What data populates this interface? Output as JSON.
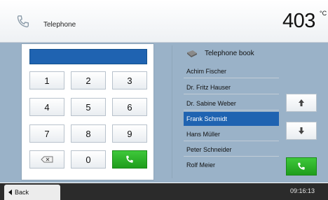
{
  "header": {
    "title": "Telephone",
    "temperature": "403",
    "unit_top": "°C",
    "unit_bottom": " "
  },
  "keypad": {
    "keys": [
      "1",
      "2",
      "3",
      "4",
      "5",
      "6",
      "7",
      "8",
      "9",
      "0"
    ]
  },
  "phonebook": {
    "title": "Telephone book",
    "entries": [
      {
        "name": "Achim Fischer",
        "selected": false
      },
      {
        "name": "Dr. Fritz Hauser",
        "selected": false
      },
      {
        "name": "Dr. Sabine Weber",
        "selected": false
      },
      {
        "name": "Frank Schmidt",
        "selected": true
      },
      {
        "name": "Hans Müller",
        "selected": false
      },
      {
        "name": "Peter Schneider",
        "selected": false
      },
      {
        "name": "Rolf Meier",
        "selected": false
      }
    ]
  },
  "footer": {
    "back_label": "Back",
    "clock": "09:16:13"
  },
  "colors": {
    "accent_blue": "#1f63b1",
    "call_green": "#2ab327",
    "panel_bg": "#9ab2c8"
  },
  "icons": {
    "header": "phone-icon",
    "backspace": "backspace-icon",
    "call": "phone-handset-icon",
    "book": "book-icon",
    "up": "arrow-up-icon",
    "down": "arrow-down-icon"
  }
}
